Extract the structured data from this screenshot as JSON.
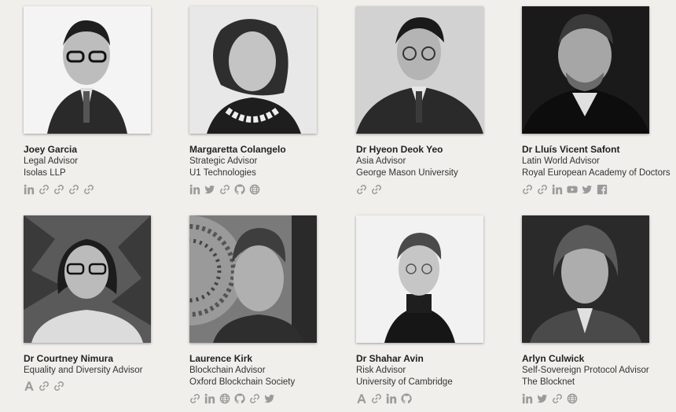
{
  "people": [
    {
      "name": "Joey Garcia",
      "role": "Legal Advisor",
      "org": "Isolas LLP",
      "icons": [
        "linkedin-icon",
        "link-icon",
        "link-icon",
        "link-icon",
        "link-icon"
      ]
    },
    {
      "name": "Margaretta Colangelo",
      "role": "Strategic Advisor",
      "org": "U1 Technologies",
      "icons": [
        "linkedin-icon",
        "twitter-icon",
        "link-icon",
        "github-icon",
        "globe-icon"
      ]
    },
    {
      "name": "Dr Hyeon Deok Yeo",
      "role": "Asia Advisor",
      "org": "George Mason University",
      "icons": [
        "link-icon",
        "link-icon"
      ]
    },
    {
      "name": "Dr Lluís Vicent Safont",
      "role": "Latin World Advisor",
      "org": "Royal European Academy of Doctors",
      "icons": [
        "link-icon",
        "link-icon",
        "linkedin-icon",
        "youtube-icon",
        "twitter-icon",
        "facebook-icon"
      ]
    },
    {
      "name": "Dr Courtney Nimura",
      "role": "Equality and Diversity Advisor",
      "org": "",
      "icons": [
        "academia-icon",
        "link-icon",
        "link-icon"
      ]
    },
    {
      "name": "Laurence Kirk",
      "role": "Blockchain Advisor",
      "org": "Oxford Blockchain Society",
      "icons": [
        "link-icon",
        "linkedin-icon",
        "globe-icon",
        "github-icon",
        "link-icon",
        "twitter-icon"
      ]
    },
    {
      "name": "Dr Shahar Avin",
      "role": "Risk Advisor",
      "org": "University of Cambridge",
      "icons": [
        "academia-icon",
        "link-icon",
        "linkedin-icon",
        "github-icon"
      ]
    },
    {
      "name": "Arlyn Culwick",
      "role": "Self-Sovereign Protocol Advisor",
      "org": "The Blocknet",
      "icons": [
        "linkedin-icon",
        "twitter-icon",
        "link-icon",
        "globe-icon"
      ]
    }
  ]
}
